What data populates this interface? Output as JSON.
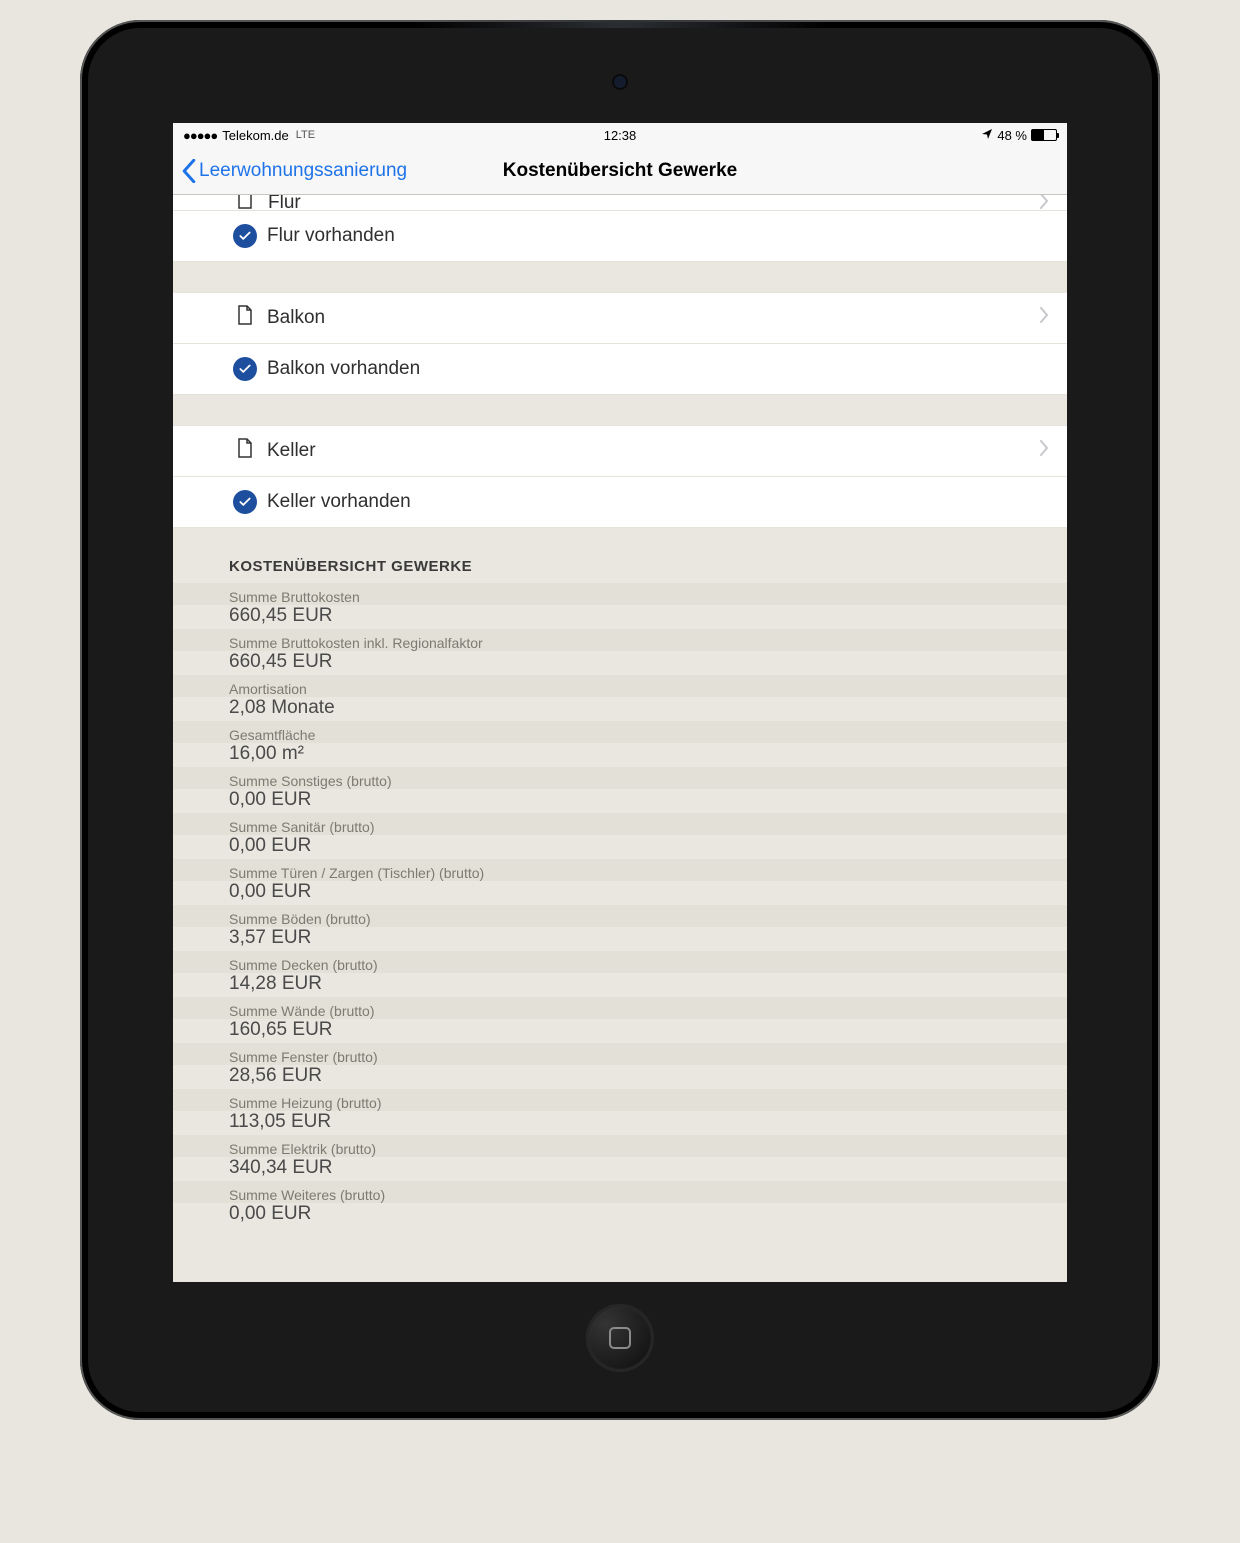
{
  "statusbar": {
    "carrier": "Telekom.de",
    "net": "LTE",
    "time": "12:38",
    "battery": "48 %"
  },
  "nav": {
    "back": "Leerwohnungssanierung",
    "title": "Kostenübersicht Gewerke"
  },
  "rooms": {
    "flur": {
      "name": "Flur",
      "status": "Flur vorhanden"
    },
    "balkon": {
      "name": "Balkon",
      "status": "Balkon vorhanden"
    },
    "keller": {
      "name": "Keller",
      "status": "Keller vorhanden"
    }
  },
  "overview": {
    "heading": "KOSTENÜBERSICHT GEWERKE",
    "rows": [
      {
        "label": "Summe Bruttokosten",
        "value": "660,45 EUR"
      },
      {
        "label": "Summe Bruttokosten inkl. Regionalfaktor",
        "value": "660,45 EUR"
      },
      {
        "label": "Amortisation",
        "value": "2,08 Monate"
      },
      {
        "label": "Gesamtfläche",
        "value": "16,00 m²"
      },
      {
        "label": "Summe Sonstiges (brutto)",
        "value": "0,00 EUR"
      },
      {
        "label": "Summe Sanitär (brutto)",
        "value": "0,00 EUR"
      },
      {
        "label": "Summe Türen / Zargen (Tischler) (brutto)",
        "value": "0,00 EUR"
      },
      {
        "label": "Summe Böden (brutto)",
        "value": "3,57 EUR"
      },
      {
        "label": "Summe Decken (brutto)",
        "value": "14,28 EUR"
      },
      {
        "label": "Summe Wände (brutto)",
        "value": "160,65 EUR"
      },
      {
        "label": "Summe Fenster (brutto)",
        "value": "28,56 EUR"
      },
      {
        "label": "Summe Heizung (brutto)",
        "value": "113,05 EUR"
      },
      {
        "label": "Summe Elektrik (brutto)",
        "value": "340,34 EUR"
      },
      {
        "label": "Summe Weiteres (brutto)",
        "value": "0,00 EUR"
      }
    ]
  }
}
